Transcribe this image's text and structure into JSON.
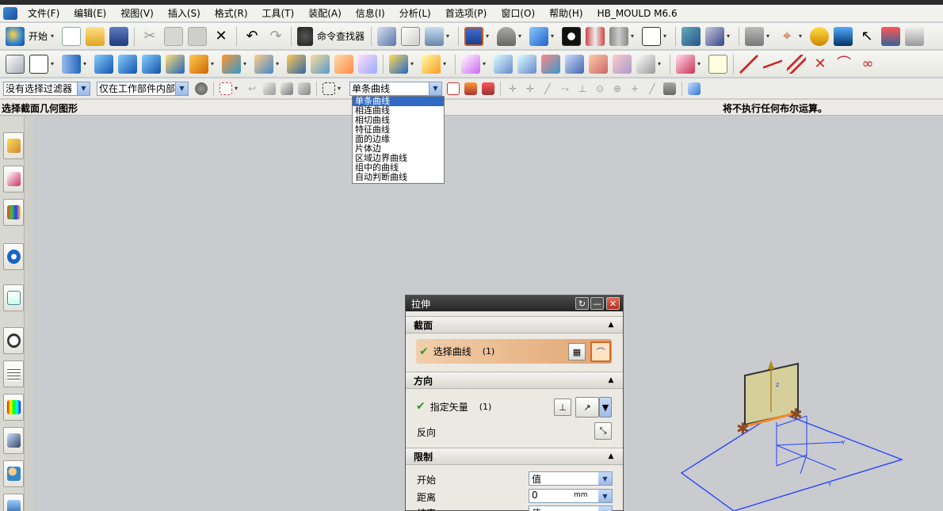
{
  "menubar": {
    "items": [
      "文件(F)",
      "编辑(E)",
      "视图(V)",
      "插入(S)",
      "格式(R)",
      "工具(T)",
      "装配(A)",
      "信息(I)",
      "分析(L)",
      "首选项(P)",
      "窗口(O)",
      "帮助(H)",
      "HB_MOULD M6.6"
    ]
  },
  "toolbar1": {
    "start_label": "开始",
    "command_finder_label": "命令查找器"
  },
  "selection_bar": {
    "filter_value": "没有选择过滤器",
    "scope_value": "仅在工作部件内部",
    "curve_rule_value": "单条曲线"
  },
  "status": {
    "prompt": "选择截面几何图形",
    "boolean_status": "将不执行任何布尔运算。"
  },
  "curve_rule_options": [
    "单条曲线",
    "相连曲线",
    "相切曲线",
    "特征曲线",
    "面的边缘",
    "片体边",
    "区域边界曲线",
    "组中的曲线",
    "自动判断曲线"
  ],
  "dialog": {
    "title": "拉伸",
    "section_label": "截面",
    "select_curve_label": "选择曲线",
    "select_curve_count": "(1)",
    "direction_label": "方向",
    "specify_vector_label": "指定矢量",
    "specify_vector_count": "(1)",
    "reverse_label": "反向",
    "limits_label": "限制",
    "start_label": "开始",
    "start_value": "值",
    "distance_label": "距离",
    "distance_value": "0",
    "distance_unit": "mm",
    "end_label": "结束",
    "end_value": "值"
  },
  "colors": {
    "selection_highlight": "#316ac5",
    "sketch_plane": "#1f3fff",
    "extrude_preview": "#d6cf9c"
  },
  "icons": [
    "start-icon",
    "new-file-icon",
    "open-folder-icon",
    "save-icon",
    "cut-icon",
    "copy-icon",
    "paste-icon",
    "delete-icon",
    "undo-icon",
    "redo-icon",
    "binoculars-icon"
  ]
}
